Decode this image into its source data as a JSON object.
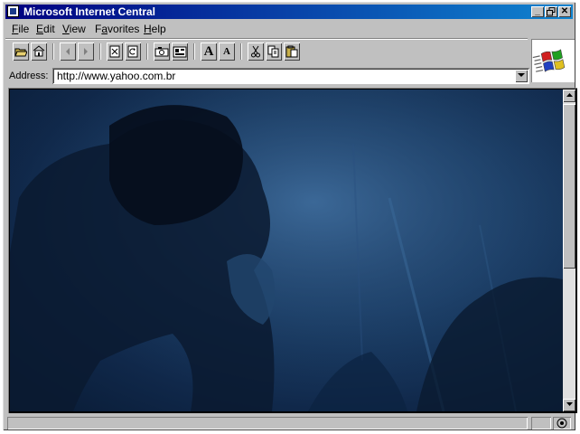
{
  "window": {
    "title": "Microsoft Internet Central"
  },
  "title_buttons": {
    "minimize": "_",
    "maximize": "□",
    "close": "✕"
  },
  "menu": [
    {
      "label": "File",
      "accel": "F",
      "rest": "ile"
    },
    {
      "label": "Edit",
      "accel": "E",
      "rest": "dit"
    },
    {
      "label": "View",
      "accel": "V",
      "rest": "iew"
    },
    {
      "label": "Favorites",
      "accel": "",
      "pre": "F",
      "mid": "a",
      "post": "vorites"
    },
    {
      "label": "Help",
      "accel": "H",
      "rest": "elp"
    }
  ],
  "menu_labels": {
    "file_a": "F",
    "file_b": "ile",
    "edit_a": "E",
    "edit_b": "dit",
    "view_a": "V",
    "view_b": "iew",
    "fav_a": "F",
    "fav_b": "a",
    "fav_c": "vorites",
    "help_a": "H",
    "help_b": "elp"
  },
  "toolbar": {
    "icons": [
      "open-folder-icon",
      "home-icon",
      "back-icon",
      "forward-icon",
      "stop-icon",
      "refresh-icon",
      "print-icon",
      "favorites-icon",
      "font-larger-icon",
      "font-smaller-icon",
      "cut-icon",
      "copy-icon",
      "paste-icon"
    ],
    "font_larger": "A",
    "font_smaller": "A"
  },
  "address": {
    "label": "Address:",
    "url": "http://www.yahoo.com.br"
  },
  "colors": {
    "titlebar": "#000080",
    "chrome": "#c0c0c0",
    "content": "#1f4570"
  }
}
